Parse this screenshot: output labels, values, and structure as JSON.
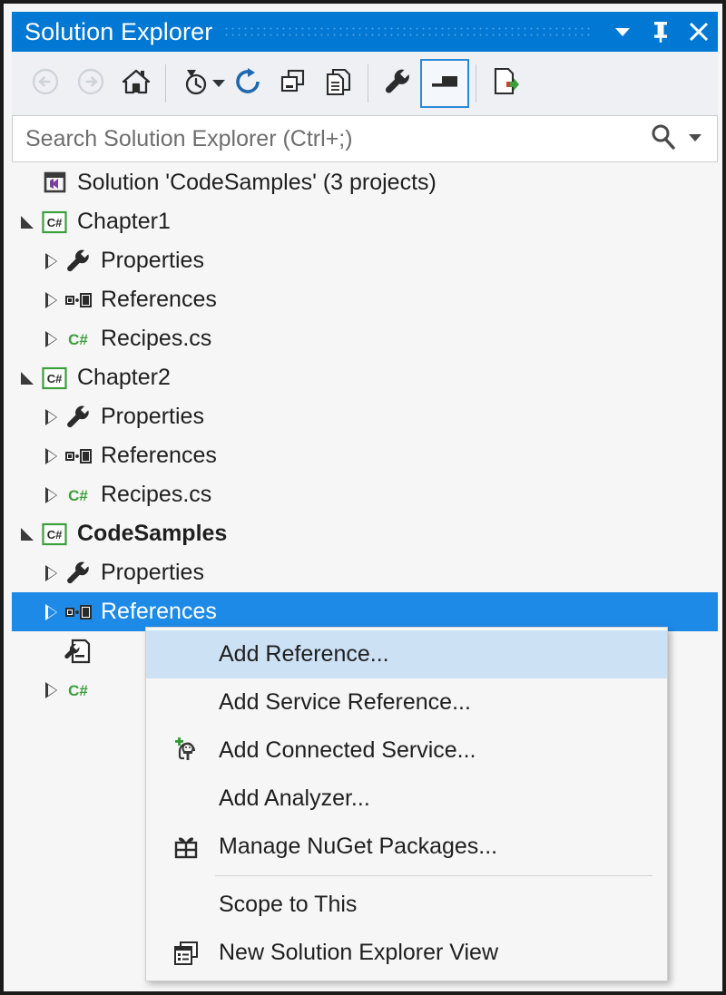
{
  "window": {
    "title": "Solution Explorer",
    "buttons": [
      {
        "name": "dropdown",
        "icon": "chevron-down-icon"
      },
      {
        "name": "pin",
        "icon": "pin-icon"
      },
      {
        "name": "close",
        "icon": "close-icon"
      }
    ]
  },
  "toolbar": {
    "items": [
      {
        "name": "back",
        "icon": "back-arrow-icon",
        "disabled": true,
        "checked": false
      },
      {
        "name": "forward",
        "icon": "forward-arrow-icon",
        "disabled": true,
        "checked": false
      },
      {
        "name": "home",
        "icon": "home-icon",
        "disabled": false,
        "checked": false
      },
      {
        "name": "separator",
        "icon": "separator"
      },
      {
        "name": "pending-changes",
        "icon": "clock-filter-icon",
        "disabled": false,
        "checked": false,
        "has_caret": true
      },
      {
        "name": "refresh",
        "icon": "refresh-icon",
        "disabled": false,
        "checked": false
      },
      {
        "name": "collapse-all",
        "icon": "collapse-all-icon",
        "disabled": false,
        "checked": false
      },
      {
        "name": "show-all-files",
        "icon": "show-all-files-icon",
        "disabled": false,
        "checked": false
      },
      {
        "name": "separator",
        "icon": "separator"
      },
      {
        "name": "properties",
        "icon": "wrench-icon",
        "disabled": false,
        "checked": false
      },
      {
        "name": "preview-selected-items",
        "icon": "preview-window-icon",
        "disabled": false,
        "checked": true
      },
      {
        "name": "separator",
        "icon": "separator"
      },
      {
        "name": "view-code",
        "icon": "view-code-icon",
        "disabled": false,
        "checked": false
      }
    ]
  },
  "search": {
    "placeholder": "Search Solution Explorer (Ctrl+;)",
    "value": "",
    "icon": "search-icon",
    "dropdown_icon": "chevron-down-icon"
  },
  "tree": {
    "rows": [
      {
        "label": "Solution 'CodeSamples' (3 projects)",
        "level": 0,
        "icon": "visual-studio-solution-icon",
        "expander": "none",
        "bold": false,
        "selected": false
      },
      {
        "label": "Chapter1",
        "level": 0,
        "icon": "csharp-project-icon",
        "expander": "expanded",
        "bold": false,
        "selected": false
      },
      {
        "label": "Properties",
        "level": 1,
        "icon": "wrench-icon",
        "expander": "collapsed",
        "bold": false,
        "selected": false
      },
      {
        "label": "References",
        "level": 1,
        "icon": "references-icon",
        "expander": "collapsed",
        "bold": false,
        "selected": false
      },
      {
        "label": "Recipes.cs",
        "level": 1,
        "icon": "csharp-file-icon",
        "expander": "collapsed",
        "bold": false,
        "selected": false
      },
      {
        "label": "Chapter2",
        "level": 0,
        "icon": "csharp-project-icon",
        "expander": "expanded",
        "bold": false,
        "selected": false
      },
      {
        "label": "Properties",
        "level": 1,
        "icon": "wrench-icon",
        "expander": "collapsed",
        "bold": false,
        "selected": false
      },
      {
        "label": "References",
        "level": 1,
        "icon": "references-icon",
        "expander": "collapsed",
        "bold": false,
        "selected": false
      },
      {
        "label": "Recipes.cs",
        "level": 1,
        "icon": "csharp-file-icon",
        "expander": "collapsed",
        "bold": false,
        "selected": false
      },
      {
        "label": "CodeSamples",
        "level": 0,
        "icon": "csharp-project-icon",
        "expander": "expanded",
        "bold": true,
        "selected": false
      },
      {
        "label": "Properties",
        "level": 1,
        "icon": "wrench-icon",
        "expander": "collapsed",
        "bold": false,
        "selected": false
      },
      {
        "label": "References",
        "level": 1,
        "icon": "references-icon",
        "expander": "collapsed",
        "bold": false,
        "selected": true
      },
      {
        "label": "",
        "level": 1,
        "icon": "app-config-icon",
        "expander": "none",
        "bold": false,
        "selected": false
      },
      {
        "label": "",
        "level": 1,
        "icon": "csharp-file-icon",
        "expander": "collapsed",
        "bold": false,
        "selected": false
      }
    ]
  },
  "context_menu": {
    "items": [
      {
        "label": "Add Reference...",
        "icon": "none",
        "highlight": true,
        "separator_after": false
      },
      {
        "label": "Add Service Reference...",
        "icon": "none",
        "highlight": false,
        "separator_after": false
      },
      {
        "label": "Add Connected Service...",
        "icon": "connected-service-icon",
        "highlight": false,
        "separator_after": false
      },
      {
        "label": "Add Analyzer...",
        "icon": "none",
        "highlight": false,
        "separator_after": false
      },
      {
        "label": "Manage NuGet Packages...",
        "icon": "nuget-icon",
        "highlight": false,
        "separator_after": true
      },
      {
        "label": "Scope to This",
        "icon": "none",
        "highlight": false,
        "separator_after": false
      },
      {
        "label": "New Solution Explorer View",
        "icon": "new-view-icon",
        "highlight": false,
        "separator_after": false
      }
    ]
  },
  "colors": {
    "title_bar": "#0078d4",
    "selection": "#1e8ae8",
    "menu_highlight": "#cde1f5",
    "accent_check": "#2a8bd8",
    "csharp_green": "#3c9e3c",
    "refresh_blue": "#1f68b0"
  }
}
